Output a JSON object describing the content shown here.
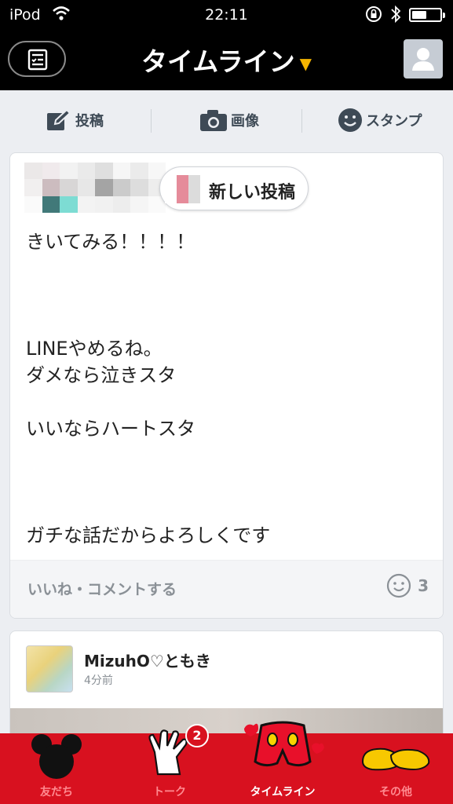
{
  "status_bar": {
    "carrier": "iPod",
    "time": "22:11"
  },
  "nav": {
    "title": "タイムライン",
    "caret": "▼"
  },
  "actions": [
    {
      "label": "投稿",
      "icon": "pencil-icon"
    },
    {
      "label": "画像",
      "icon": "camera-icon"
    },
    {
      "label": "スタンプ",
      "icon": "smiley-icon"
    }
  ],
  "post1": {
    "new_post_label": "新しい投稿",
    "body": "きいてみる！！！！\n\n\n\nLINEやめるね。\nダメなら泣きスタ\n\nいいならハートスタ\n\n\n\nガチな話だからよろしくです",
    "footer_label": "いいね・コメントする",
    "reaction_count": "3"
  },
  "post2": {
    "name": "MizuhO♡ともき",
    "time": "4分前"
  },
  "tabs": [
    {
      "label": "友だち",
      "icon": "mickey-head-icon"
    },
    {
      "label": "トーク",
      "icon": "glove-icon"
    },
    {
      "label": "タイムライン",
      "icon": "shorts-icon"
    },
    {
      "label": "その他",
      "icon": "shoes-icon"
    }
  ],
  "talk_badge": "2",
  "colors": {
    "tabbar": "#d8111f",
    "accent_caret": "#f4b400",
    "nav_bg": "#000000"
  }
}
